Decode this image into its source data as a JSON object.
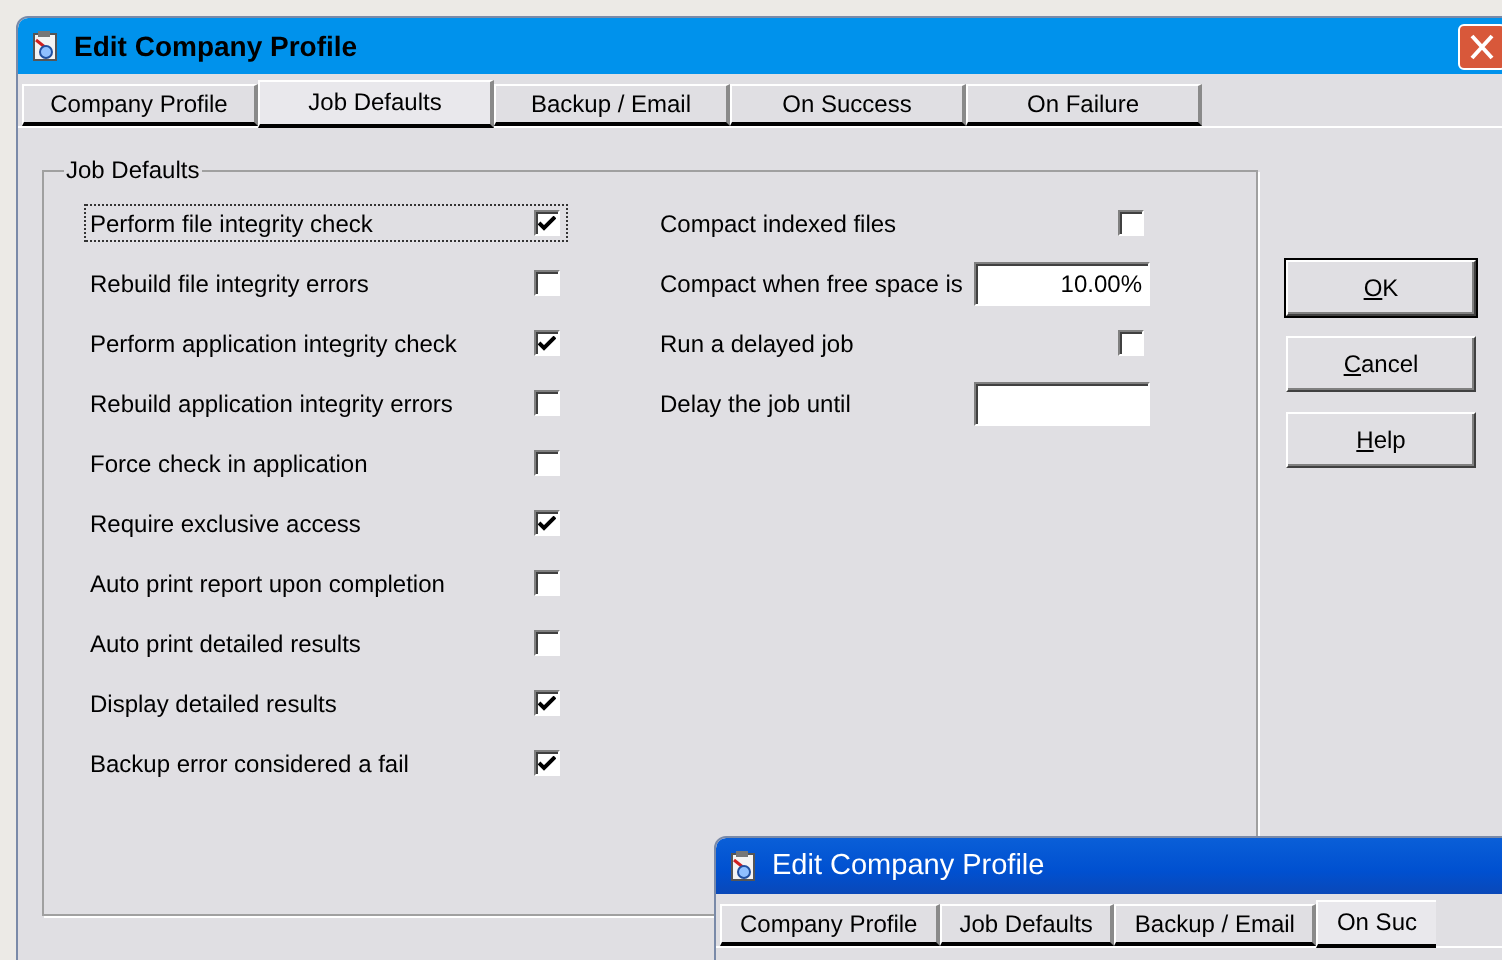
{
  "main_window": {
    "title": "Edit Company Profile",
    "active": false,
    "tabs": [
      {
        "label": "Company Profile",
        "selected": false
      },
      {
        "label": "Job Defaults",
        "selected": true
      },
      {
        "label": "Backup / Email",
        "selected": false
      },
      {
        "label": "On Success",
        "selected": false
      },
      {
        "label": "On Failure",
        "selected": false
      }
    ],
    "group": {
      "title": "Job Defaults",
      "left_options": [
        {
          "label": "Perform file integrity check",
          "checked": true,
          "focused": true
        },
        {
          "label": "Rebuild file integrity errors",
          "checked": false,
          "focused": false
        },
        {
          "label": "Perform application integrity check",
          "checked": true,
          "focused": false
        },
        {
          "label": "Rebuild application integrity errors",
          "checked": false,
          "focused": false
        },
        {
          "label": "Force check in application",
          "checked": false,
          "focused": false
        },
        {
          "label": "Require exclusive access",
          "checked": true,
          "focused": false
        },
        {
          "label": "Auto print report upon completion",
          "checked": false,
          "focused": false
        },
        {
          "label": "Auto print detailed results",
          "checked": false,
          "focused": false
        },
        {
          "label": "Display detailed results",
          "checked": true,
          "focused": false
        },
        {
          "label": "Backup error considered a fail",
          "checked": true,
          "focused": false
        }
      ],
      "right_options": [
        {
          "kind": "checkbox",
          "label": "Compact indexed files",
          "checked": false
        },
        {
          "kind": "field",
          "label": "Compact when free space is",
          "value": "10.00%"
        },
        {
          "kind": "checkbox",
          "label": "Run a delayed job",
          "checked": false
        },
        {
          "kind": "field",
          "label": "Delay the job until"
        }
      ]
    },
    "buttons": [
      {
        "label": "OK",
        "default": true
      },
      {
        "label": "Cancel",
        "default": false
      },
      {
        "label": "Help",
        "default": false
      }
    ]
  },
  "front_window": {
    "title": "Edit Company Profile",
    "active": true,
    "tabs": [
      {
        "label": "Company Profile",
        "selected": false
      },
      {
        "label": "Job Defaults",
        "selected": false
      },
      {
        "label": "Backup / Email",
        "selected": false
      },
      {
        "label": "On Suc",
        "selected": true
      }
    ]
  }
}
